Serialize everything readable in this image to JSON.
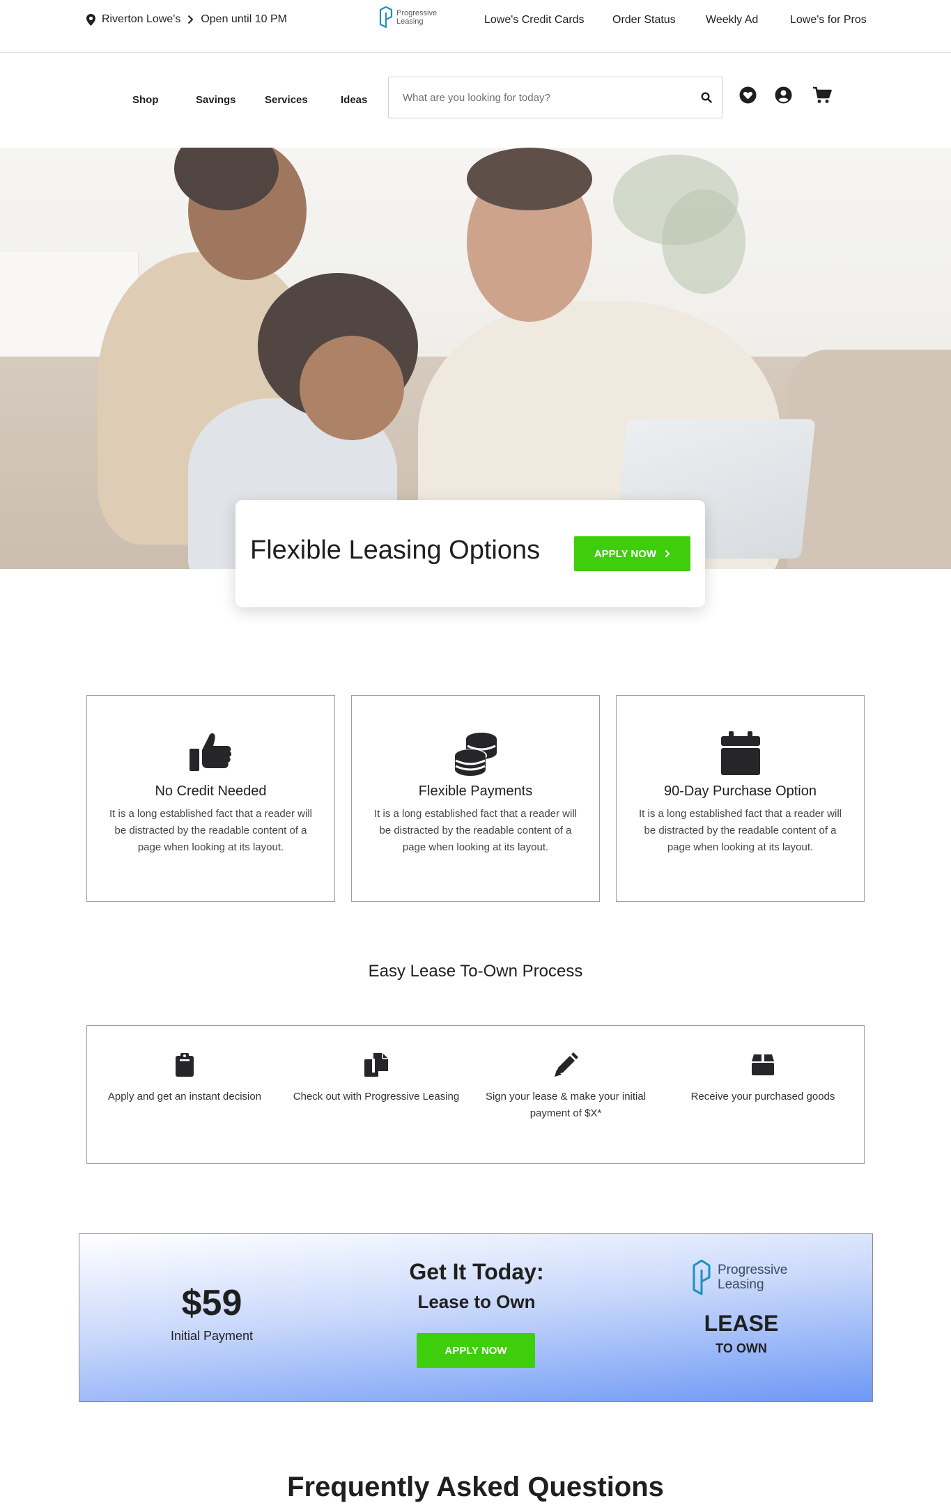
{
  "topbar": {
    "store_name": "Riverton Lowe's",
    "store_hours": "Open until 10 PM",
    "brand_line1": "Progressive",
    "brand_line2": "Leasing",
    "links": [
      "Lowe's Credit Cards",
      "Order Status",
      "Weekly Ad",
      "Lowe's for Pros"
    ]
  },
  "nav": {
    "items": [
      "Shop",
      "Savings",
      "Services",
      "Ideas"
    ],
    "search_placeholder": "What are you looking for today?",
    "icons": [
      "search-icon",
      "heart-icon",
      "account-icon",
      "cart-icon"
    ]
  },
  "hero": {
    "title": "Flexible Leasing Options",
    "cta": "APPLY NOW"
  },
  "features": [
    {
      "icon": "thumbs-up-icon",
      "title": "No Credit Needed",
      "text": "It is a long established fact that a reader will be distracted by the readable content of a page when looking at its layout."
    },
    {
      "icon": "coins-icon",
      "title": "Flexible Payments",
      "text": "It is a long established fact that a reader will be distracted by the readable content of a page when looking at its layout."
    },
    {
      "icon": "calendar-icon",
      "title": "90-Day Purchase Option",
      "text": "It is a long established fact that a reader will be distracted by the readable content of a page when looking at its layout."
    }
  ],
  "process": {
    "title": "Easy Lease To-Own Process",
    "steps": [
      {
        "icon": "clipboard-icon",
        "text": "Apply and get an instant decision"
      },
      {
        "icon": "copy-icon",
        "text": "Check out with Progressive Leasing"
      },
      {
        "icon": "pen-icon",
        "text": "Sign your lease & make your initial payment of $X*"
      },
      {
        "icon": "box-icon",
        "text": "Receive your purchased goods"
      }
    ]
  },
  "promo": {
    "price": "$59",
    "price_label": "Initial Payment",
    "headline": "Get It Today:",
    "subheadline": "Lease to Own",
    "cta": "APPLY NOW",
    "brand_line1": "Progressive",
    "brand_line2": "Leasing",
    "lease": "LEASE",
    "to_own": "TO OWN"
  },
  "faq": {
    "title": "Frequently Asked Questions"
  },
  "colors": {
    "accent_green": "#3fce0b",
    "brand_teal": "#1f8fc0",
    "promo_gradient_end": "#6f98f5"
  }
}
